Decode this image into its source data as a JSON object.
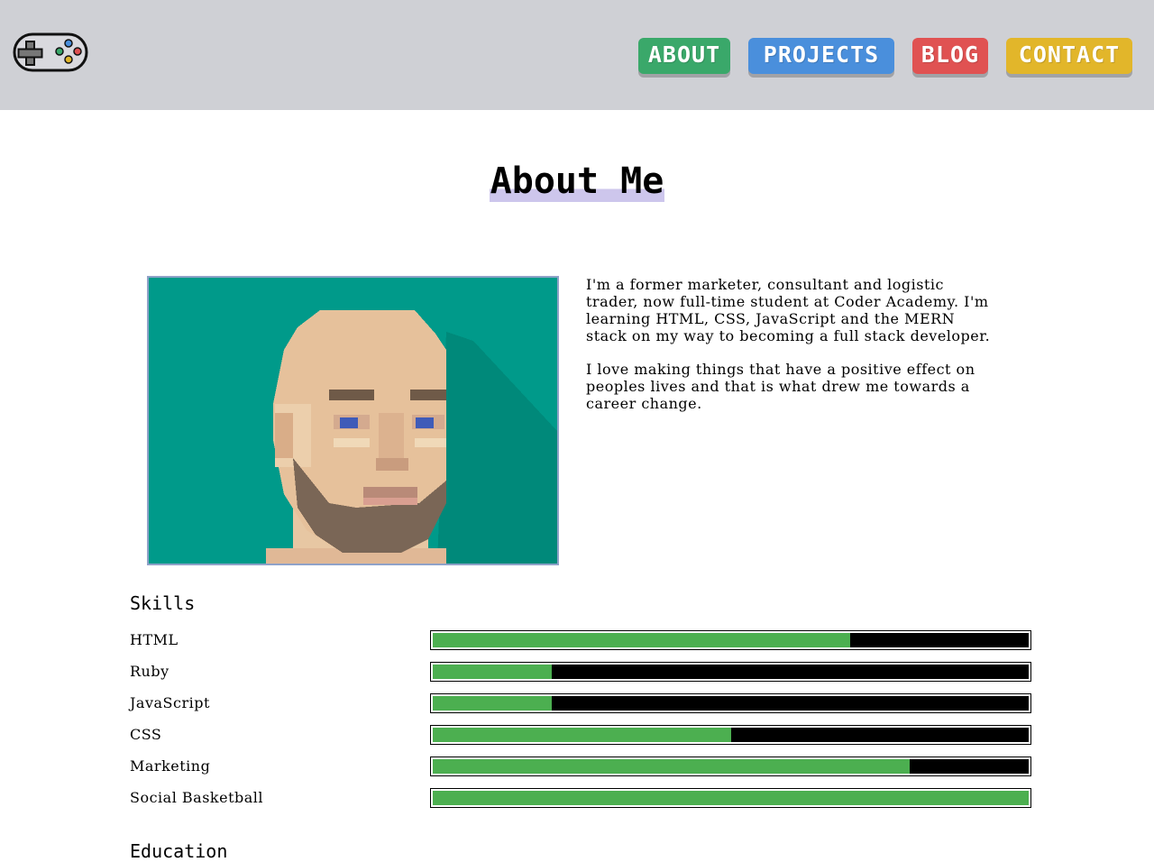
{
  "nav": {
    "about": {
      "label": "ABOUT",
      "color": "#3aa86a"
    },
    "projects": {
      "label": "PROJECTS",
      "color": "#4a8fdc"
    },
    "blog": {
      "label": "BLOG",
      "color": "#e05252"
    },
    "contact": {
      "label": "CONTACT",
      "color": "#e2b62a"
    }
  },
  "logo": {
    "icon": "gamepad-icon"
  },
  "main": {
    "title": "About Me",
    "portrait": {
      "icon": "pixel-portrait",
      "background": "#009a8a"
    },
    "bio": [
      "I'm a former marketer, consultant and logistic trader, now full-time student at Coder Academy. I'm learning HTML, CSS, JavaScript and the MERN stack on my way to becoming a full stack developer.",
      "I love making things that have a positive effect on peoples lives and that is what drew me towards a career change."
    ]
  },
  "skills": {
    "heading": "Skills",
    "bar_color": "#4caf50",
    "items": [
      {
        "name": "HTML",
        "level": 0.7
      },
      {
        "name": "Ruby",
        "level": 0.2
      },
      {
        "name": "JavaScript",
        "level": 0.2
      },
      {
        "name": "CSS",
        "level": 0.5
      },
      {
        "name": "Marketing",
        "level": 0.8
      },
      {
        "name": "Social Basketball",
        "level": 1.0
      }
    ]
  },
  "education": {
    "heading": "Education"
  }
}
